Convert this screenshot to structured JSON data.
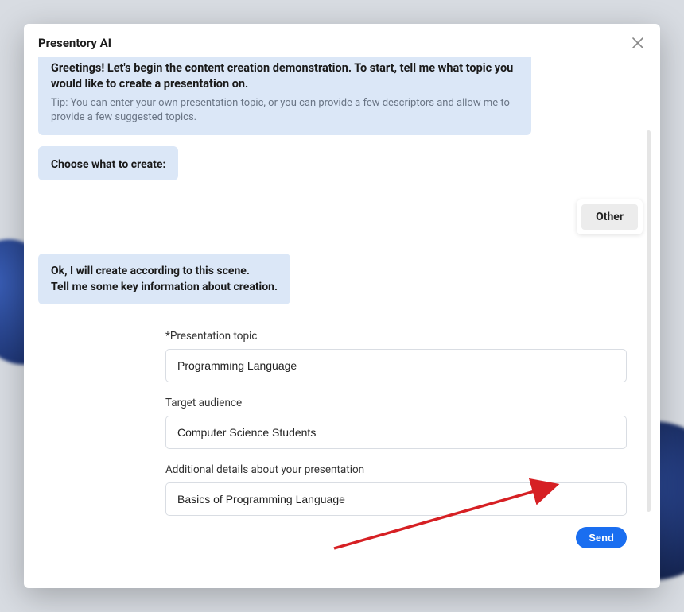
{
  "modal": {
    "title": "Presentory AI"
  },
  "greeting": {
    "headline": "Greetings! Let's begin the content creation demonstration. To start, tell me what topic you would like to create a presentation on.",
    "tip": "Tip: You can enter your own presentation topic, or you can provide a few descriptors and allow me to provide a few suggested topics."
  },
  "choose": {
    "label": "Choose what to create:"
  },
  "user_choice": "Other",
  "confirm": {
    "line1": "Ok, I will create according to this scene.",
    "line2": "Tell me some key information about creation."
  },
  "form": {
    "topic_label": "*Presentation topic",
    "topic_value": "Programming Language",
    "audience_label": "Target audience",
    "audience_value": "Computer Science Students",
    "details_label": "Additional details about your presentation",
    "details_value": "Basics of Programming Language",
    "send_label": "Send"
  },
  "colors": {
    "accent": "#1a6ef0",
    "bubble": "#dbe7f7"
  }
}
